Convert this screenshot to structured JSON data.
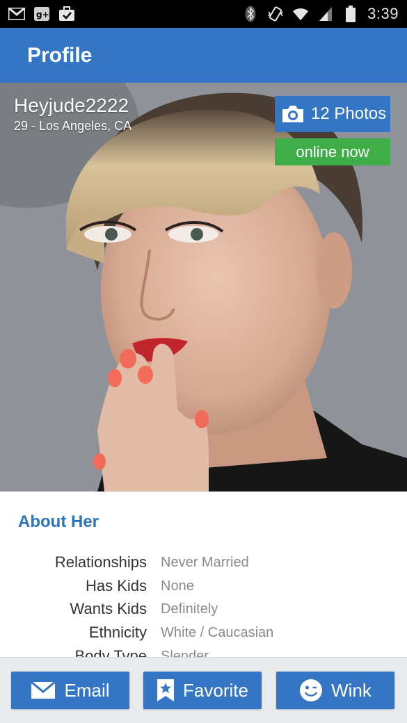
{
  "status_bar": {
    "time": "3:39",
    "left_icons": [
      "gmail-icon",
      "google-plus-icon",
      "tasks-bag-icon"
    ],
    "right_icons": [
      "bluetooth-icon",
      "vibrate-icon",
      "wifi-icon",
      "signal-icon",
      "battery-icon"
    ]
  },
  "app_bar": {
    "title": "Profile",
    "color": "#3576c4"
  },
  "profile": {
    "username": "Heyjude2222",
    "meta": "29 - Los Angeles, CA",
    "photos_label": "12 Photos",
    "online_label": "online now",
    "online_color": "#3fae49"
  },
  "about": {
    "heading": "About Her",
    "rows": [
      {
        "label": "Relationships",
        "value": "Never Married"
      },
      {
        "label": "Has Kids",
        "value": "None"
      },
      {
        "label": "Wants Kids",
        "value": "Definitely"
      },
      {
        "label": "Ethnicity",
        "value": "White / Caucasian"
      },
      {
        "label": "Body Type",
        "value": "Slender"
      }
    ]
  },
  "actions": {
    "email": "Email",
    "favorite": "Favorite",
    "wink": "Wink"
  }
}
